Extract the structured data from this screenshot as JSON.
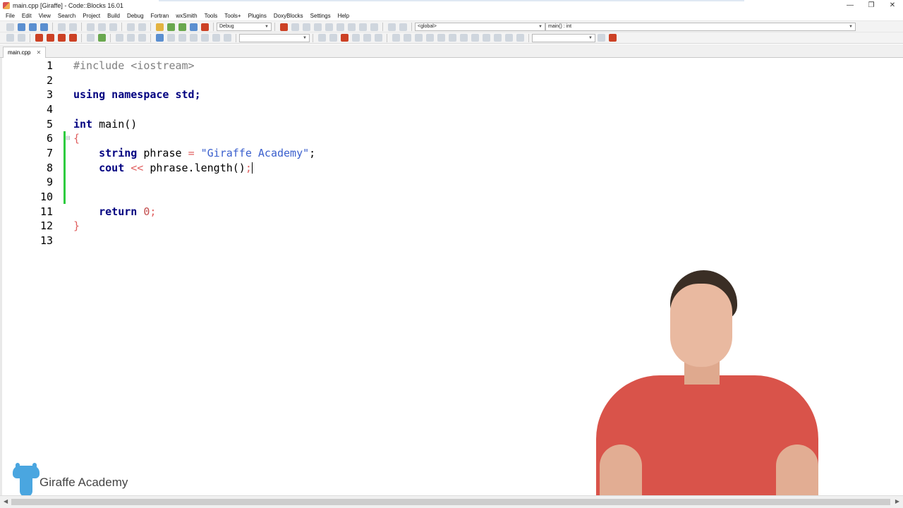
{
  "window": {
    "title": "main.cpp [Giraffe] - Code::Blocks 16.01",
    "controls": {
      "minimize": "—",
      "restore": "❐",
      "close": "✕"
    }
  },
  "menu": [
    "File",
    "Edit",
    "View",
    "Search",
    "Project",
    "Build",
    "Debug",
    "Fortran",
    "wxSmith",
    "Tools",
    "Tools+",
    "Plugins",
    "DoxyBlocks",
    "Settings",
    "Help"
  ],
  "toolbar": {
    "build_target": "Debug",
    "scope": "<global>",
    "function": "main() : int"
  },
  "tab": {
    "label": "main.cpp",
    "close": "✕"
  },
  "editor": {
    "line_numbers": [
      "1",
      "2",
      "3",
      "4",
      "5",
      "6",
      "7",
      "8",
      "9",
      "10",
      "11",
      "12",
      "13"
    ],
    "lines": {
      "l1": "#include <iostream>",
      "l3_kw": "using namespace",
      "l3_rest": " std;",
      "l5_kw": "int",
      "l5_rest": " main()",
      "l6": "{",
      "l7_type": "string",
      "l7_var": " phrase ",
      "l7_eq": "=",
      "l7_str": "\"Giraffe Academy\"",
      "l7_end": ";",
      "l8_cout": "cout ",
      "l8_op": "<<",
      "l8_rest": " phrase.length()",
      "l8_end": ";",
      "l11_kw": "return",
      "l11_num": "0",
      "l11_end": ";",
      "l12": "}"
    }
  },
  "branding": {
    "logo_text": "Giraffe Academy"
  }
}
